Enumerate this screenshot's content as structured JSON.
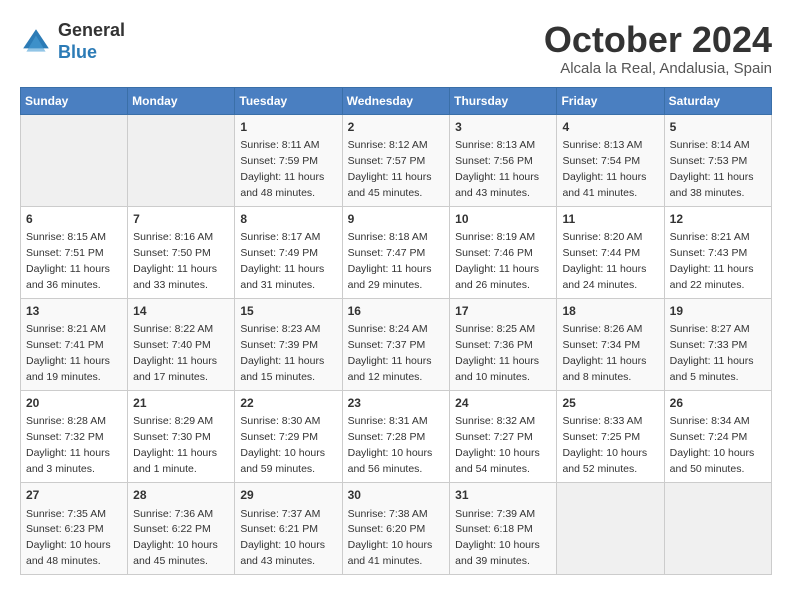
{
  "header": {
    "logo_general": "General",
    "logo_blue": "Blue",
    "month_title": "October 2024",
    "location": "Alcala la Real, Andalusia, Spain"
  },
  "weekdays": [
    "Sunday",
    "Monday",
    "Tuesday",
    "Wednesday",
    "Thursday",
    "Friday",
    "Saturday"
  ],
  "weeks": [
    [
      {
        "day": "",
        "info": ""
      },
      {
        "day": "",
        "info": ""
      },
      {
        "day": "1",
        "info": "Sunrise: 8:11 AM\nSunset: 7:59 PM\nDaylight: 11 hours and 48 minutes."
      },
      {
        "day": "2",
        "info": "Sunrise: 8:12 AM\nSunset: 7:57 PM\nDaylight: 11 hours and 45 minutes."
      },
      {
        "day": "3",
        "info": "Sunrise: 8:13 AM\nSunset: 7:56 PM\nDaylight: 11 hours and 43 minutes."
      },
      {
        "day": "4",
        "info": "Sunrise: 8:13 AM\nSunset: 7:54 PM\nDaylight: 11 hours and 41 minutes."
      },
      {
        "day": "5",
        "info": "Sunrise: 8:14 AM\nSunset: 7:53 PM\nDaylight: 11 hours and 38 minutes."
      }
    ],
    [
      {
        "day": "6",
        "info": "Sunrise: 8:15 AM\nSunset: 7:51 PM\nDaylight: 11 hours and 36 minutes."
      },
      {
        "day": "7",
        "info": "Sunrise: 8:16 AM\nSunset: 7:50 PM\nDaylight: 11 hours and 33 minutes."
      },
      {
        "day": "8",
        "info": "Sunrise: 8:17 AM\nSunset: 7:49 PM\nDaylight: 11 hours and 31 minutes."
      },
      {
        "day": "9",
        "info": "Sunrise: 8:18 AM\nSunset: 7:47 PM\nDaylight: 11 hours and 29 minutes."
      },
      {
        "day": "10",
        "info": "Sunrise: 8:19 AM\nSunset: 7:46 PM\nDaylight: 11 hours and 26 minutes."
      },
      {
        "day": "11",
        "info": "Sunrise: 8:20 AM\nSunset: 7:44 PM\nDaylight: 11 hours and 24 minutes."
      },
      {
        "day": "12",
        "info": "Sunrise: 8:21 AM\nSunset: 7:43 PM\nDaylight: 11 hours and 22 minutes."
      }
    ],
    [
      {
        "day": "13",
        "info": "Sunrise: 8:21 AM\nSunset: 7:41 PM\nDaylight: 11 hours and 19 minutes."
      },
      {
        "day": "14",
        "info": "Sunrise: 8:22 AM\nSunset: 7:40 PM\nDaylight: 11 hours and 17 minutes."
      },
      {
        "day": "15",
        "info": "Sunrise: 8:23 AM\nSunset: 7:39 PM\nDaylight: 11 hours and 15 minutes."
      },
      {
        "day": "16",
        "info": "Sunrise: 8:24 AM\nSunset: 7:37 PM\nDaylight: 11 hours and 12 minutes."
      },
      {
        "day": "17",
        "info": "Sunrise: 8:25 AM\nSunset: 7:36 PM\nDaylight: 11 hours and 10 minutes."
      },
      {
        "day": "18",
        "info": "Sunrise: 8:26 AM\nSunset: 7:34 PM\nDaylight: 11 hours and 8 minutes."
      },
      {
        "day": "19",
        "info": "Sunrise: 8:27 AM\nSunset: 7:33 PM\nDaylight: 11 hours and 5 minutes."
      }
    ],
    [
      {
        "day": "20",
        "info": "Sunrise: 8:28 AM\nSunset: 7:32 PM\nDaylight: 11 hours and 3 minutes."
      },
      {
        "day": "21",
        "info": "Sunrise: 8:29 AM\nSunset: 7:30 PM\nDaylight: 11 hours and 1 minute."
      },
      {
        "day": "22",
        "info": "Sunrise: 8:30 AM\nSunset: 7:29 PM\nDaylight: 10 hours and 59 minutes."
      },
      {
        "day": "23",
        "info": "Sunrise: 8:31 AM\nSunset: 7:28 PM\nDaylight: 10 hours and 56 minutes."
      },
      {
        "day": "24",
        "info": "Sunrise: 8:32 AM\nSunset: 7:27 PM\nDaylight: 10 hours and 54 minutes."
      },
      {
        "day": "25",
        "info": "Sunrise: 8:33 AM\nSunset: 7:25 PM\nDaylight: 10 hours and 52 minutes."
      },
      {
        "day": "26",
        "info": "Sunrise: 8:34 AM\nSunset: 7:24 PM\nDaylight: 10 hours and 50 minutes."
      }
    ],
    [
      {
        "day": "27",
        "info": "Sunrise: 7:35 AM\nSunset: 6:23 PM\nDaylight: 10 hours and 48 minutes."
      },
      {
        "day": "28",
        "info": "Sunrise: 7:36 AM\nSunset: 6:22 PM\nDaylight: 10 hours and 45 minutes."
      },
      {
        "day": "29",
        "info": "Sunrise: 7:37 AM\nSunset: 6:21 PM\nDaylight: 10 hours and 43 minutes."
      },
      {
        "day": "30",
        "info": "Sunrise: 7:38 AM\nSunset: 6:20 PM\nDaylight: 10 hours and 41 minutes."
      },
      {
        "day": "31",
        "info": "Sunrise: 7:39 AM\nSunset: 6:18 PM\nDaylight: 10 hours and 39 minutes."
      },
      {
        "day": "",
        "info": ""
      },
      {
        "day": "",
        "info": ""
      }
    ]
  ]
}
